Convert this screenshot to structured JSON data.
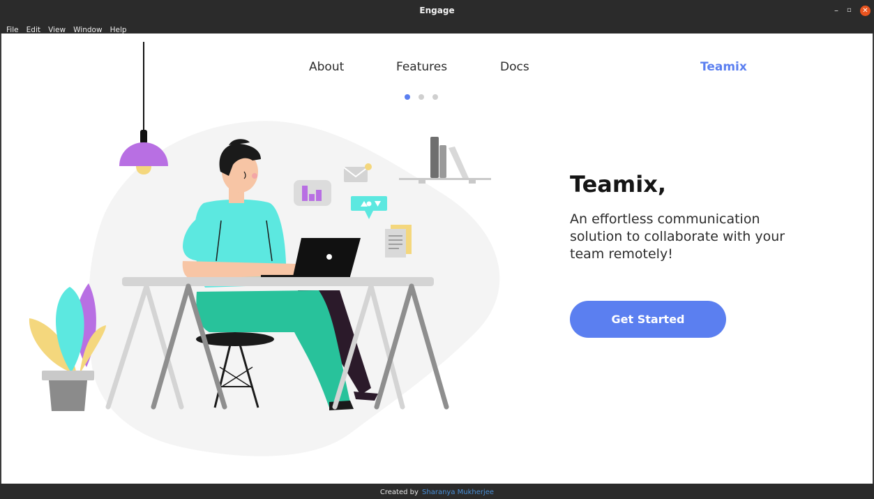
{
  "window": {
    "title": "Engage",
    "controls": {
      "minimize": "–",
      "maximize": "▫",
      "close": "✕"
    }
  },
  "menu": [
    "File",
    "Edit",
    "View",
    "Window",
    "Help"
  ],
  "nav": {
    "links": [
      "About",
      "Features",
      "Docs"
    ],
    "brand": "Teamix",
    "carousel": {
      "slides": 3,
      "active": 0
    }
  },
  "hero": {
    "title": "Teamix,",
    "subtitle": "An effortless communication solution to collaborate with your team remotely!",
    "cta_label": "Get Started"
  },
  "footer": {
    "prefix": "Created by",
    "author": "Sharanya Mukherjee"
  },
  "colors": {
    "accent": "#5b7ff0",
    "chrome": "#2b2b2b",
    "shirt": "#5ce8e0",
    "pants": "#28c29b",
    "lamp": "#b86fe3"
  }
}
